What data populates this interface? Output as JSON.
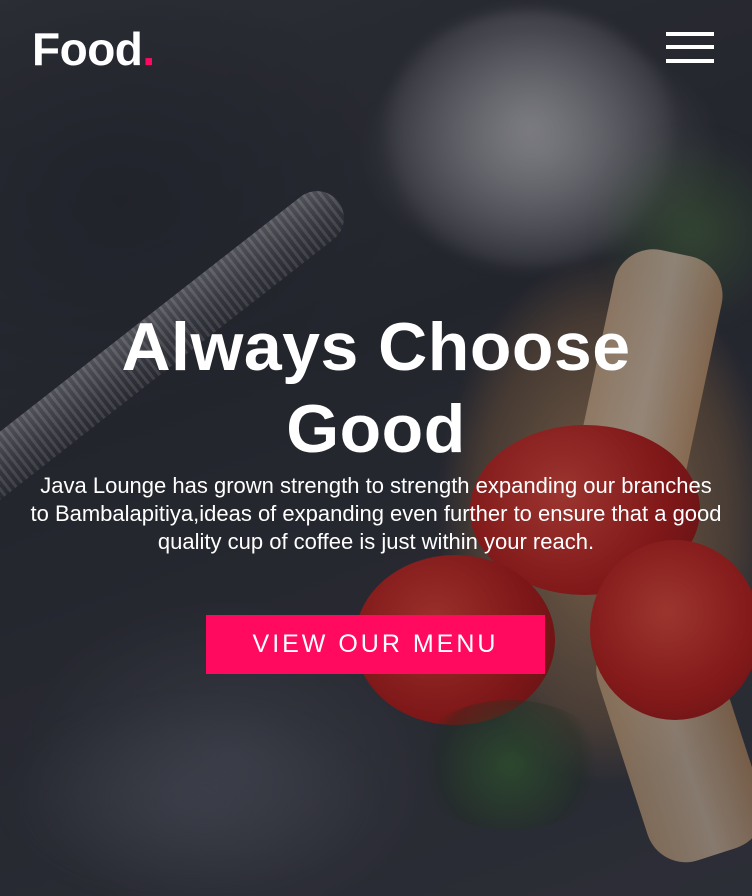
{
  "header": {
    "logo_text": "Food",
    "logo_dot": ".",
    "menu_icon": "hamburger-menu-icon"
  },
  "hero": {
    "headline": "Always Choose Good",
    "description": "Java Lounge has grown strength to strength expanding our branches to Bambalapitiya,ideas of expanding even further to ensure that a good quality cup of coffee is just within your reach.",
    "cta_label": "VIEW OUR MENU"
  },
  "colors": {
    "accent": "#ff0a5f",
    "text": "#ffffff"
  }
}
